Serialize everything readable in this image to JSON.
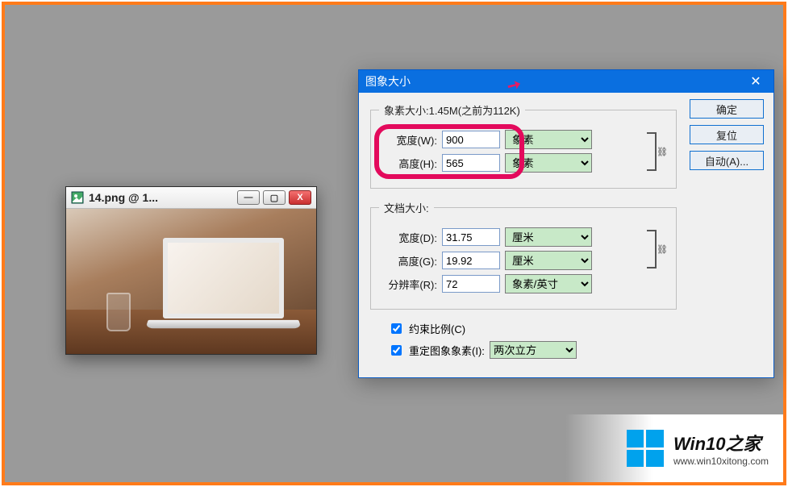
{
  "imgwin": {
    "title": "14.png @ 1...",
    "min": "—",
    "max": "▢",
    "close": "X"
  },
  "dialog": {
    "title": "图象大小",
    "close": "✕",
    "pixel_group_legend": "象素大小:1.45M(之前为112K)",
    "width_label": "宽度(W):",
    "width_value": "900",
    "height_label": "高度(H):",
    "height_value": "565",
    "pixel_unit": "象素",
    "doc_group_legend": "文档大小:",
    "doc_width_label": "宽度(D):",
    "doc_width_value": "31.75",
    "doc_height_label": "高度(G):",
    "doc_height_value": "19.92",
    "doc_unit": "厘米",
    "res_label": "分辨率(R):",
    "res_value": "72",
    "res_unit": "象素/英寸",
    "constrain_label": "约束比例(C)",
    "resample_label": "重定图象象素(I):",
    "resample_method": "两次立方",
    "ok_label": "确定",
    "reset_label": "复位",
    "auto_label": "自动(A)..."
  },
  "watermark": {
    "title": "Win10之家",
    "url": "www.win10xitong.com"
  }
}
